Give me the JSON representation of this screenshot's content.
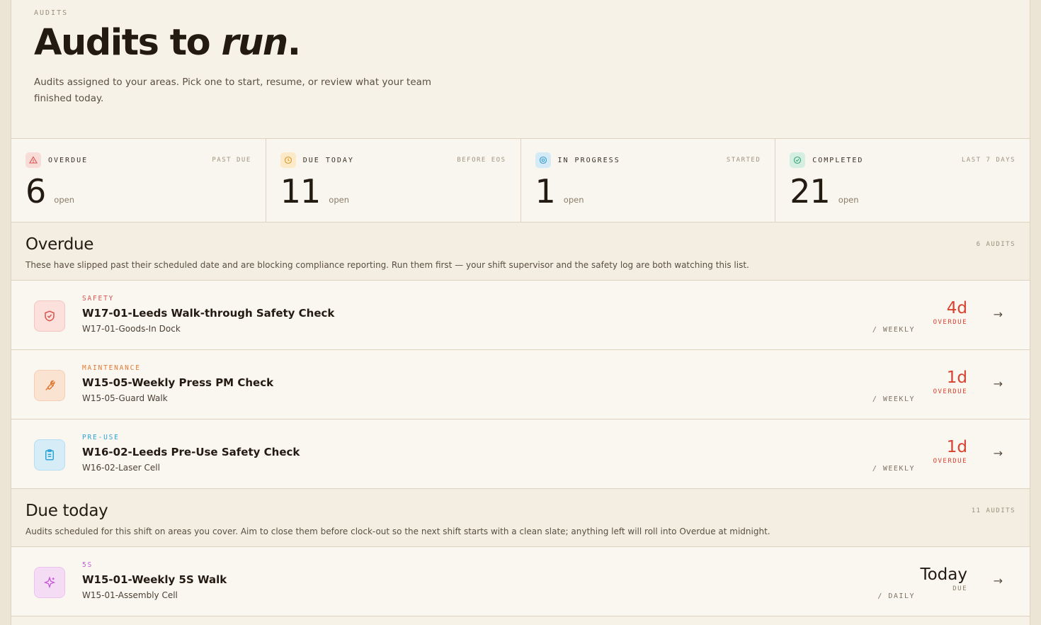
{
  "header": {
    "eyebrow": "AUDITS",
    "title_main": "Audits to ",
    "title_emphasis": "run",
    "title_end": ".",
    "subtitle": "Audits assigned to your areas. Pick one to start, resume, or review what your team finished today."
  },
  "stats": [
    {
      "label": "OVERDUE",
      "hint": "PAST DUE",
      "value": "6",
      "unit": "open",
      "icon": "alert-triangle-icon",
      "color": "#d9534f",
      "bg": "#f8dcd8"
    },
    {
      "label": "DUE TODAY",
      "hint": "BEFORE EOS",
      "value": "11",
      "unit": "open",
      "icon": "clock-icon",
      "color": "#d89a2b",
      "bg": "#fbe9c8"
    },
    {
      "label": "IN PROGRESS",
      "hint": "STARTED",
      "value": "1",
      "unit": "open",
      "icon": "target-icon",
      "color": "#3a9bd1",
      "bg": "#d4ebf7"
    },
    {
      "label": "COMPLETED",
      "hint": "LAST 7 DAYS",
      "value": "21",
      "unit": "open",
      "icon": "check-circle-icon",
      "color": "#3aa57a",
      "bg": "#d4efe2"
    }
  ],
  "sections": [
    {
      "title": "Overdue",
      "count": "6 AUDITS",
      "description": "These have slipped past their scheduled date and are blocking compliance reporting. Run them first — your shift supervisor and the safety log are both watching this list.",
      "rows": [
        {
          "category": "SAFETY",
          "title": "W17-01-Leeds Walk-through Safety Check",
          "sub": "W17-01-Goods-In Dock",
          "freq": "/ WEEKLY",
          "due_value": "4d",
          "due_label": "OVERDUE",
          "icon": "shield-check-icon",
          "cat_color": "#d9534f",
          "icon_bg": "#fbe0dc",
          "icon_color": "#d9534f",
          "due_color": "#d9412f"
        },
        {
          "category": "MAINTENANCE",
          "title": "W15-05-Weekly Press PM Check",
          "sub": "W15-05-Guard Walk",
          "freq": "/ WEEKLY",
          "due_value": "1d",
          "due_label": "OVERDUE",
          "icon": "wrench-icon",
          "cat_color": "#e07a35",
          "icon_bg": "#fbe3d2",
          "icon_color": "#e07a35",
          "due_color": "#d9412f"
        },
        {
          "category": "PRE-USE",
          "title": "W16-02-Leeds Pre-Use Safety Check",
          "sub": "W16-02-Laser Cell",
          "freq": "/ WEEKLY",
          "due_value": "1d",
          "due_label": "OVERDUE",
          "icon": "clipboard-icon",
          "cat_color": "#2fa3d6",
          "icon_bg": "#d6edf8",
          "icon_color": "#2fa3d6",
          "due_color": "#d9412f"
        }
      ]
    },
    {
      "title": "Due today",
      "count": "11 AUDITS",
      "description": "Audits scheduled for this shift on areas you cover. Aim to close them before clock-out so the next shift starts with a clean slate; anything left will roll into Overdue at midnight.",
      "rows": [
        {
          "category": "5S",
          "title": "W15-01-Weekly 5S Walk",
          "sub": "W15-01-Assembly Cell",
          "freq": "/ DAILY",
          "due_value": "Today",
          "due_label": "DUE",
          "icon": "sparkle-icon",
          "cat_color": "#c45bd6",
          "icon_bg": "#f5dcf5",
          "icon_color": "#c45bd6",
          "due_color": "#231a12"
        }
      ]
    }
  ]
}
